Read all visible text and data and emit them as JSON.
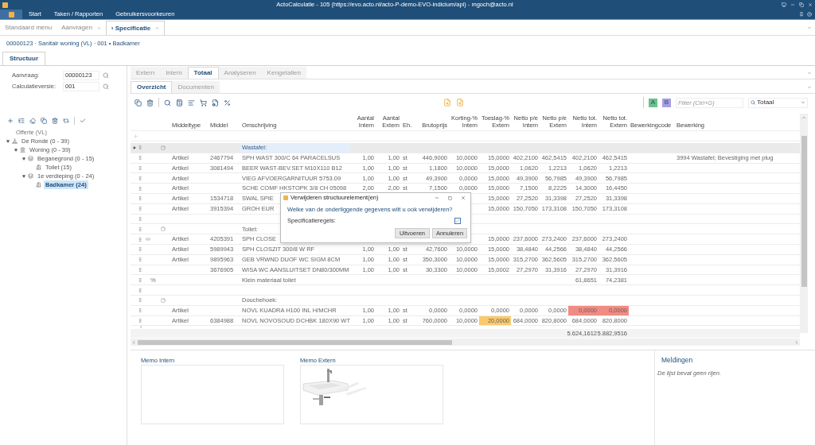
{
  "window": {
    "title": "ActoCalculatie - 105 (https://evo.acto.nl/acto-P-demo-EVO-indicium/api) - mgoch@acto.nl"
  },
  "menu": {
    "items": [
      "Start",
      "Taken / Rapporten",
      "Gebruikersvoorkeuren"
    ]
  },
  "doc_tabs": [
    {
      "label": "Standaard menu",
      "closable": false,
      "selected": false
    },
    {
      "label": "Aanvragen",
      "closable": true,
      "selected": false
    },
    {
      "label": "› Specificatie",
      "closable": true,
      "selected": true
    }
  ],
  "breadcrumb": "00000123 · Sanitair woning (VL) · 001 • Badkamer",
  "section_tabs": [
    {
      "label": "Structuur",
      "selected": true
    }
  ],
  "fields": [
    {
      "label": "Aanvraag:",
      "value": "00000123"
    },
    {
      "label": "Calculatieversie:",
      "value": "001"
    }
  ],
  "tree": {
    "root": "Offerte (VL)",
    "items": [
      {
        "label": "De Ronde (0 - 39)",
        "kind": "project",
        "expanded": true,
        "selected": false,
        "children": [
          {
            "label": "Woning (0 - 39)",
            "kind": "building",
            "expanded": true,
            "selected": false,
            "children": [
              {
                "label": "Beganegrond (0 - 15)",
                "kind": "floor",
                "expanded": true,
                "selected": false,
                "children": [
                  {
                    "label": "Toilet (15)",
                    "kind": "room",
                    "selected": false
                  }
                ]
              },
              {
                "label": "1e verdieping (0 - 24)",
                "kind": "floor",
                "expanded": true,
                "selected": false,
                "children": [
                  {
                    "label": "Badkamer (24)",
                    "kind": "room",
                    "selected": true
                  }
                ]
              }
            ]
          }
        ]
      }
    ]
  },
  "main_tabs": [
    {
      "label": "Extern",
      "selected": false
    },
    {
      "label": "Intern",
      "selected": false
    },
    {
      "label": "Totaal",
      "selected": true
    },
    {
      "label": "Analyseren",
      "selected": false
    },
    {
      "label": "Kengetallen",
      "selected": false
    }
  ],
  "sub_tabs": [
    {
      "label": "Overzicht",
      "selected": true
    },
    {
      "label": "Documenten",
      "selected": false
    }
  ],
  "toolbar": {
    "color_buttons": [
      {
        "label": "A",
        "color": "#6cc28a"
      },
      {
        "label": "B",
        "color": "#a89ee0"
      }
    ],
    "filter": {
      "placeholder": "Filter (Ctrl+G)"
    },
    "view_select": {
      "value": "Totaal"
    }
  },
  "table": {
    "columns": [
      {
        "label": "Middeltype",
        "numeric": false
      },
      {
        "label": "Middel",
        "numeric": false
      },
      {
        "label": "Omschrijving",
        "numeric": false
      },
      {
        "label": "Aantal\nIntern",
        "numeric": true
      },
      {
        "label": "Aantal\nExtern",
        "numeric": true
      },
      {
        "label": "Eh.",
        "numeric": false
      },
      {
        "label": "Brutoprijs",
        "numeric": true
      },
      {
        "label": "Korting-%\nIntern",
        "numeric": true
      },
      {
        "label": "Toeslag-%\nExtern",
        "numeric": true
      },
      {
        "label": "Netto p/e\nIntern",
        "numeric": true
      },
      {
        "label": "Netto p/e\nExtern",
        "numeric": true
      },
      {
        "label": "Netto tot.\nIntern",
        "numeric": true
      },
      {
        "label": "Netto tot.\nExtern",
        "numeric": true
      },
      {
        "label": "Bewerkingcode",
        "numeric": false
      },
      {
        "label": "Bewerking",
        "numeric": false
      }
    ],
    "rows": [
      {
        "kind": "group",
        "selected": true,
        "linked": false,
        "cells": [
          null,
          null,
          "Wastafel:",
          null,
          null,
          null,
          null,
          null,
          null,
          null,
          null,
          null,
          null,
          null,
          null
        ]
      },
      {
        "kind": "article",
        "selected": false,
        "linked": false,
        "cells": [
          "Artikel",
          "2467794",
          "SPH WAST 300/C 64 PARACELSUS",
          "1,00",
          "1,00",
          "st",
          "446,9000",
          "10,0000",
          "15,0000",
          "402,2100",
          "462,5415",
          "402,2100",
          "462,5415",
          null,
          "3994 Wastafel; Bevestiging met plug"
        ]
      },
      {
        "kind": "article",
        "selected": false,
        "linked": false,
        "cells": [
          "Artikel",
          "3081494",
          "BEER WAST-BEV.SET M10X110 B12",
          "1,00",
          "1,00",
          "st",
          "1,1800",
          "10,0000",
          "15,0000",
          "1,0620",
          "1,2213",
          "1,0620",
          "1,2213",
          null,
          null
        ]
      },
      {
        "kind": "article",
        "selected": false,
        "linked": false,
        "cells": [
          "Artikel",
          null,
          "VIEG AFVOERGARNITUUR 5753.09",
          "1,00",
          "1,00",
          "st",
          "49,3900",
          "0,0000",
          "15,0000",
          "49,3900",
          "56,7985",
          "49,3900",
          "56,7985",
          null,
          null
        ]
      },
      {
        "kind": "article",
        "selected": false,
        "linked": false,
        "cells": [
          "Artikel",
          null,
          "SCHE COMF HKSTOPK 3/8 CH 05098",
          "2,00",
          "2,00",
          "st",
          "7,1500",
          "0,0000",
          "15,0000",
          "7,1500",
          "8,2225",
          "14,3000",
          "16,4450",
          null,
          null
        ]
      },
      {
        "kind": "article",
        "selected": false,
        "linked": false,
        "cells": [
          "Artikel",
          "1534718",
          "SWAL SPIE",
          null,
          null,
          null,
          null,
          null,
          "15,0000",
          "27,2520",
          "31,3398",
          "27,2520",
          "31,3398",
          null,
          null
        ]
      },
      {
        "kind": "article",
        "selected": false,
        "linked": false,
        "cells": [
          "Artikel",
          "3915394",
          "GROH EUR",
          null,
          null,
          null,
          null,
          null,
          "15,0000",
          "150,7050",
          "173,3108",
          "150,7050",
          "173,3108",
          null,
          null
        ]
      },
      {
        "kind": "empty",
        "selected": false,
        "linked": false,
        "cells": [
          null,
          null,
          null,
          null,
          null,
          null,
          null,
          null,
          null,
          null,
          null,
          null,
          null,
          null,
          null
        ]
      },
      {
        "kind": "group",
        "selected": false,
        "linked": false,
        "cells": [
          null,
          null,
          "Toilet:",
          null,
          null,
          null,
          null,
          null,
          null,
          null,
          null,
          null,
          null,
          null,
          null
        ]
      },
      {
        "kind": "article",
        "selected": false,
        "linked": true,
        "cells": [
          "Artikel",
          "4205391",
          "SPH CLOSE",
          null,
          null,
          null,
          null,
          null,
          "15,0000",
          "237,6000",
          "273,2400",
          "237,6000",
          "273,2400",
          null,
          null
        ]
      },
      {
        "kind": "article",
        "selected": false,
        "linked": false,
        "cells": [
          "Artikel",
          "5989943",
          "SPH CLOSZIT 300/8 W RF",
          "1,00",
          "1,00",
          "st",
          "42,7600",
          "10,0000",
          "15,0000",
          "38,4840",
          "44,2566",
          "38,4840",
          "44,2566",
          null,
          null
        ]
      },
      {
        "kind": "article",
        "selected": false,
        "linked": false,
        "cells": [
          "Artikel",
          "9895963",
          "GEB VRWND DUOF WC SIGM 8CM",
          "1,00",
          "1,00",
          "st",
          "350,3000",
          "10,0000",
          "15,0000",
          "315,2700",
          "362,5605",
          "315,2700",
          "362,5605",
          null,
          null
        ]
      },
      {
        "kind": "article",
        "selected": false,
        "linked": false,
        "cells": [
          null,
          "3676905",
          "WISA WC AANSLUITSET DN80/300MM",
          "1,00",
          "1,00",
          "st",
          "30,3300",
          "10,0000",
          "15,0002",
          "27,2970",
          "31,3916",
          "27,2970",
          "31,3916",
          null,
          null
        ]
      },
      {
        "kind": "percent",
        "selected": false,
        "linked": false,
        "marker": "%",
        "cells": [
          null,
          null,
          "Klein materiaal toilet",
          null,
          null,
          null,
          null,
          null,
          null,
          null,
          null,
          "61,8651",
          "74,2381",
          null,
          null
        ]
      },
      {
        "kind": "empty",
        "selected": false,
        "linked": false,
        "cells": [
          null,
          null,
          null,
          null,
          null,
          null,
          null,
          null,
          null,
          null,
          null,
          null,
          null,
          null,
          null
        ]
      },
      {
        "kind": "group",
        "selected": false,
        "linked": false,
        "cells": [
          null,
          null,
          "Douchehoek:",
          null,
          null,
          null,
          null,
          null,
          null,
          null,
          null,
          null,
          null,
          null,
          null
        ]
      },
      {
        "kind": "article",
        "selected": false,
        "linked": false,
        "cells": [
          "Artikel",
          null,
          "NOVL KUADRA H100 INL H/MCHR",
          "1,00",
          "1,00",
          "st",
          "0,0000",
          "0,0000",
          "0,0000",
          "0,0000",
          "0,0000",
          {
            "text": "0,0000",
            "color": "#f28b82"
          },
          {
            "text": "0,0000",
            "color": "#f28b82"
          },
          null,
          null
        ]
      },
      {
        "kind": "article",
        "selected": false,
        "linked": false,
        "cells": [
          "Artikel",
          "6384988",
          "NOVL NOVOSOUD DCHBK 180X90 WT",
          "1,00",
          "1,00",
          "st",
          "760,0000",
          "10,0000",
          {
            "text": "20,0000",
            "color": "#fbc96b"
          },
          "684,0000",
          "820,8000",
          "684,0000",
          "820,8000",
          null,
          null
        ]
      }
    ],
    "totals": {
      "netto_tot_intern": "5.624,1612",
      "netto_tot_extern": "5.882,9516"
    }
  },
  "memos": [
    {
      "title": "Memo Intern",
      "kind": "empty"
    },
    {
      "title": "Memo Extern",
      "kind": "picture"
    }
  ],
  "messages": {
    "title": "Meldingen",
    "empty_text": "De lijst bevat geen rijen."
  },
  "dialog": {
    "title": "Verwijderen structuurelement(en)",
    "question": "Welke van de onderliggende gegevens wilt u ook verwijderen?",
    "option": {
      "label": "Specificatieregels:",
      "checked": true
    },
    "buttons": [
      "Uitvoeren",
      "Annuleren"
    ]
  }
}
